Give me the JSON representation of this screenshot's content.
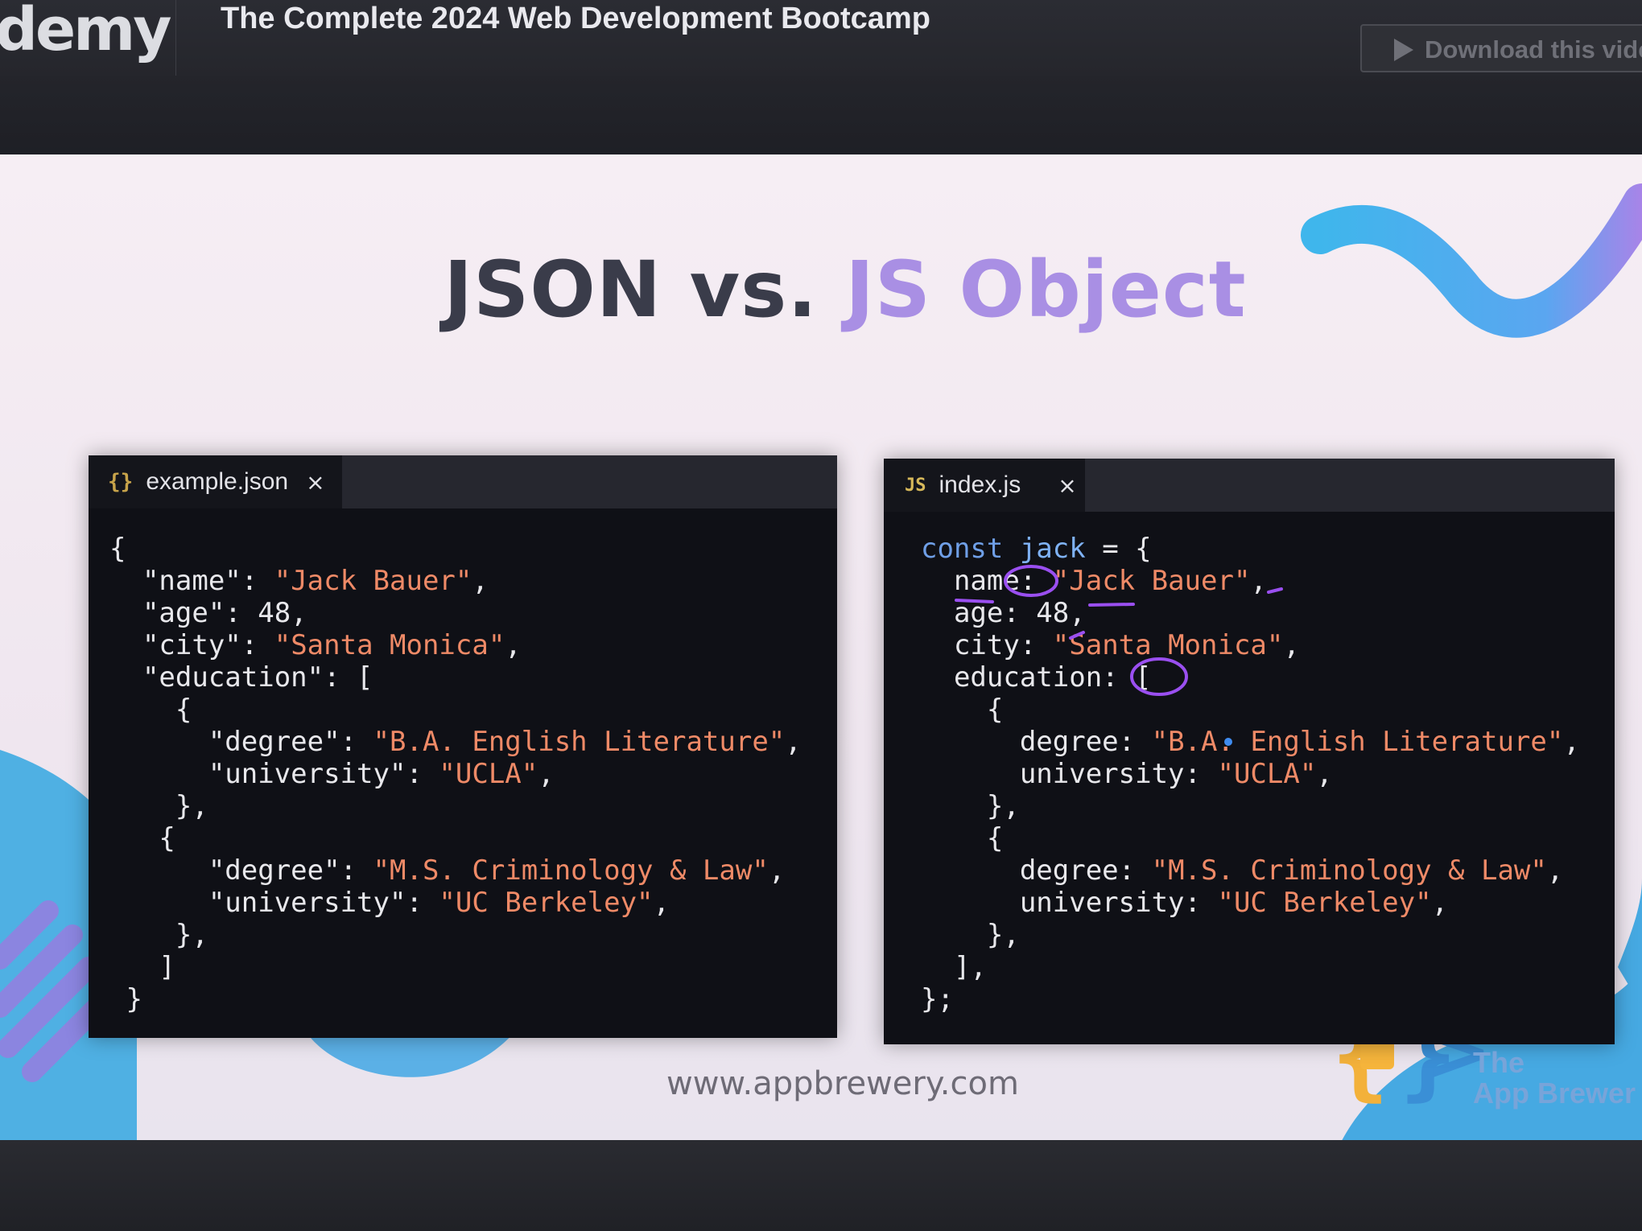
{
  "header": {
    "brand": "demy",
    "course_title": "The Complete 2024 Web Development Bootcamp",
    "download_label": "Download this vide"
  },
  "slide": {
    "title_part1": "JSON vs.",
    "title_part2": "JS Object",
    "footer_url": "www.appbrewery.com",
    "brand_line1": "The",
    "brand_line2": "App Brewer"
  },
  "json_editor": {
    "tab_icon": "{}",
    "tab_name": "example.json",
    "close": "×",
    "lines": [
      [
        {
          "c": "p",
          "t": "{"
        }
      ],
      [
        {
          "c": "k",
          "t": "  \"name\""
        },
        {
          "c": "p",
          "t": ": "
        },
        {
          "c": "s",
          "t": "\"Jack Bauer\""
        },
        {
          "c": "p",
          "t": ","
        }
      ],
      [
        {
          "c": "k",
          "t": "  \"age\""
        },
        {
          "c": "p",
          "t": ": 48,"
        }
      ],
      [
        {
          "c": "k",
          "t": "  \"city\""
        },
        {
          "c": "p",
          "t": ": "
        },
        {
          "c": "s",
          "t": "\"Santa Monica\""
        },
        {
          "c": "p",
          "t": ","
        }
      ],
      [
        {
          "c": "k",
          "t": "  \"education\""
        },
        {
          "c": "p",
          "t": ": ["
        }
      ],
      [
        {
          "c": "p",
          "t": "    {"
        }
      ],
      [
        {
          "c": "k",
          "t": "      \"degree\""
        },
        {
          "c": "p",
          "t": ": "
        },
        {
          "c": "s",
          "t": "\"B.A. English Literature\""
        },
        {
          "c": "p",
          "t": ","
        }
      ],
      [
        {
          "c": "k",
          "t": "      \"university\""
        },
        {
          "c": "p",
          "t": ": "
        },
        {
          "c": "s",
          "t": "\"UCLA\""
        },
        {
          "c": "p",
          "t": ","
        }
      ],
      [
        {
          "c": "p",
          "t": "    },"
        }
      ],
      [
        {
          "c": "p",
          "t": "   {"
        }
      ],
      [
        {
          "c": "k",
          "t": "      \"degree\""
        },
        {
          "c": "p",
          "t": ": "
        },
        {
          "c": "s",
          "t": "\"M.S. Criminology & Law\""
        },
        {
          "c": "p",
          "t": ","
        }
      ],
      [
        {
          "c": "k",
          "t": "      \"university\""
        },
        {
          "c": "p",
          "t": ": "
        },
        {
          "c": "s",
          "t": "\"UC Berkeley\""
        },
        {
          "c": "p",
          "t": ","
        }
      ],
      [
        {
          "c": "p",
          "t": "    },"
        }
      ],
      [
        {
          "c": "p",
          "t": "   ]"
        }
      ],
      [
        {
          "c": "p",
          "t": " }"
        }
      ]
    ]
  },
  "js_editor": {
    "tab_icon": "JS",
    "tab_name": "index.js",
    "close": "×",
    "lines": [
      [
        {
          "c": "kw",
          "t": "const "
        },
        {
          "c": "id",
          "t": "jack"
        },
        {
          "c": "p",
          "t": " = {"
        }
      ],
      [
        {
          "c": "k",
          "t": "  name"
        },
        {
          "c": "p",
          "t": ": "
        },
        {
          "c": "s",
          "t": "\"Jack Bauer\""
        },
        {
          "c": "p",
          "t": ","
        }
      ],
      [
        {
          "c": "k",
          "t": "  age"
        },
        {
          "c": "p",
          "t": ": 48,"
        }
      ],
      [
        {
          "c": "k",
          "t": "  city"
        },
        {
          "c": "p",
          "t": ": "
        },
        {
          "c": "s",
          "t": "\"Santa Monica\""
        },
        {
          "c": "p",
          "t": ","
        }
      ],
      [
        {
          "c": "k",
          "t": "  education"
        },
        {
          "c": "p",
          "t": ": ["
        }
      ],
      [
        {
          "c": "p",
          "t": "    {"
        }
      ],
      [
        {
          "c": "k",
          "t": "      degree"
        },
        {
          "c": "p",
          "t": ": "
        },
        {
          "c": "s",
          "t": "\"B.A. English Literature\""
        },
        {
          "c": "p",
          "t": ","
        }
      ],
      [
        {
          "c": "k",
          "t": "      university"
        },
        {
          "c": "p",
          "t": ": "
        },
        {
          "c": "s",
          "t": "\"UCLA\""
        },
        {
          "c": "p",
          "t": ","
        }
      ],
      [
        {
          "c": "p",
          "t": "    },"
        }
      ],
      [
        {
          "c": "p",
          "t": "    {"
        }
      ],
      [
        {
          "c": "k",
          "t": "      degree"
        },
        {
          "c": "p",
          "t": ": "
        },
        {
          "c": "s",
          "t": "\"M.S. Criminology & Law\""
        },
        {
          "c": "p",
          "t": ","
        }
      ],
      [
        {
          "c": "k",
          "t": "      university"
        },
        {
          "c": "p",
          "t": ": "
        },
        {
          "c": "s",
          "t": "\"UC Berkeley\""
        },
        {
          "c": "p",
          "t": ","
        }
      ],
      [
        {
          "c": "p",
          "t": "    },"
        }
      ],
      [
        {
          "c": "p",
          "t": "  ],"
        }
      ],
      [
        {
          "c": "p",
          "t": "};"
        }
      ]
    ]
  },
  "colors": {
    "title_dark": "#3a3c4a",
    "title_accent": "#a98fe4",
    "string": "#ef8a67",
    "keyword": "#6f9fe7",
    "annotation": "#9a4ff0"
  }
}
